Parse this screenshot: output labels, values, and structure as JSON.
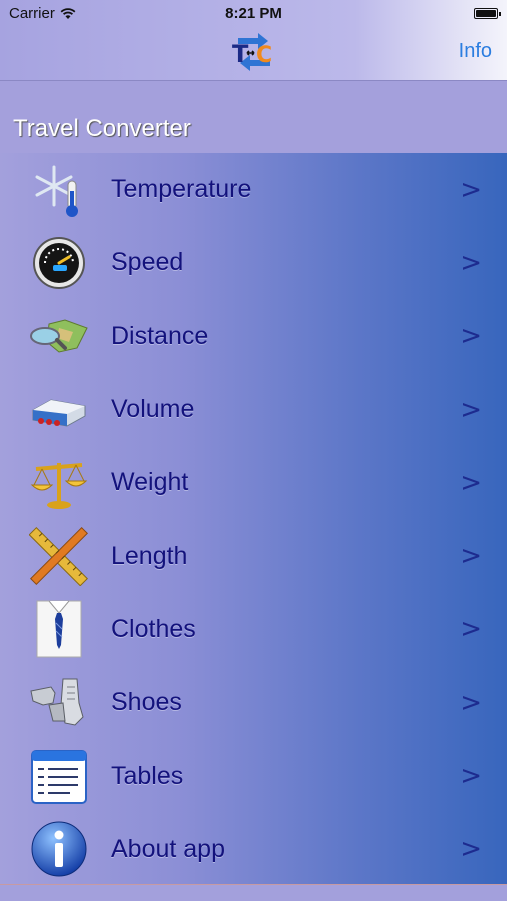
{
  "status": {
    "carrier": "Carrier",
    "time": "8:21 PM"
  },
  "nav": {
    "info_label": "Info",
    "logo_icon": "travel-converter-logo-icon"
  },
  "section": {
    "title": "Travel Converter"
  },
  "items": [
    {
      "label": "Temperature",
      "icon": "snowflake-thermometer-icon"
    },
    {
      "label": "Speed",
      "icon": "speedometer-icon"
    },
    {
      "label": "Distance",
      "icon": "map-magnifier-icon"
    },
    {
      "label": "Volume",
      "icon": "tanker-truck-icon"
    },
    {
      "label": "Weight",
      "icon": "scales-icon"
    },
    {
      "label": "Length",
      "icon": "ruler-icon"
    },
    {
      "label": "Clothes",
      "icon": "shirt-tie-icon"
    },
    {
      "label": "Shoes",
      "icon": "shoes-icon"
    },
    {
      "label": "Tables",
      "icon": "table-icon"
    },
    {
      "label": "About app",
      "icon": "info-icon"
    }
  ],
  "chevron": ">"
}
